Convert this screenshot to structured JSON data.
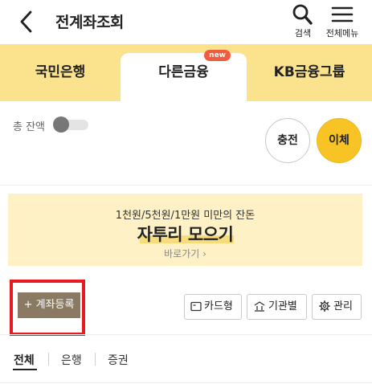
{
  "header": {
    "title": "전계좌조회",
    "search_label": "검색",
    "menu_label": "전체메뉴"
  },
  "tabs": [
    {
      "label": "국민은행",
      "active": false
    },
    {
      "label": "다른금융",
      "active": true,
      "badge": "new"
    },
    {
      "label": "KB금융그룹",
      "active": false
    }
  ],
  "balance": {
    "label": "총 잔액",
    "toggle_on": false,
    "charge_label": "충전",
    "transfer_label": "이체"
  },
  "banner": {
    "subtitle": "1천원/5천원/1만원 미만의 잔돈",
    "title": "자투리 모으기",
    "link": "바로가기 ›"
  },
  "toolbar": {
    "register_label": "+ 계좌등록",
    "card_view_label": "카드형",
    "by_institution_label": "기관별",
    "manage_label": "관리"
  },
  "filters": [
    {
      "label": "전체",
      "active": true
    },
    {
      "label": "은행",
      "active": false
    },
    {
      "label": "증권",
      "active": false
    }
  ],
  "colors": {
    "tab_bar": "#fbe28d",
    "transfer_button": "#f7c325",
    "banner_bg": "#fdf1c5",
    "register_button": "#8a7a63",
    "highlight_box": "#e8191f",
    "new_badge": "#f25b3c"
  }
}
